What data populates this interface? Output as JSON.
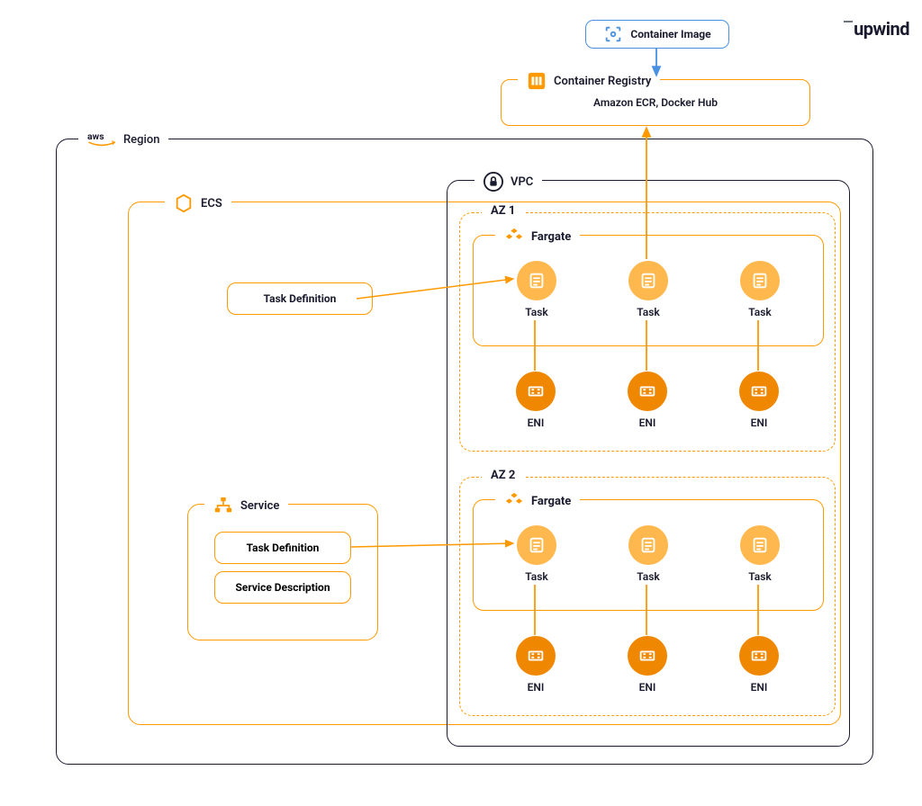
{
  "brand": "upwind",
  "container_image_label": "Container Image",
  "registry": {
    "title": "Container Registry",
    "subtitle": "Amazon ECR, Docker Hub"
  },
  "region_label": "Region",
  "aws_label": "aws",
  "ecs_label": "ECS",
  "vpc_label": "VPC",
  "az1_label": "AZ 1",
  "az2_label": "AZ 2",
  "fargate_label": "Fargate",
  "task_label": "Task",
  "eni_label": "ENI",
  "task_definition_label": "Task Definition",
  "service_label": "Service",
  "service_description_label": "Service Description",
  "colors": {
    "orange": "#ff9900",
    "orange_dark": "#f08700",
    "orange_light": "#ffb84d",
    "blue": "#4a90e2",
    "dark": "#1a1a2e"
  }
}
